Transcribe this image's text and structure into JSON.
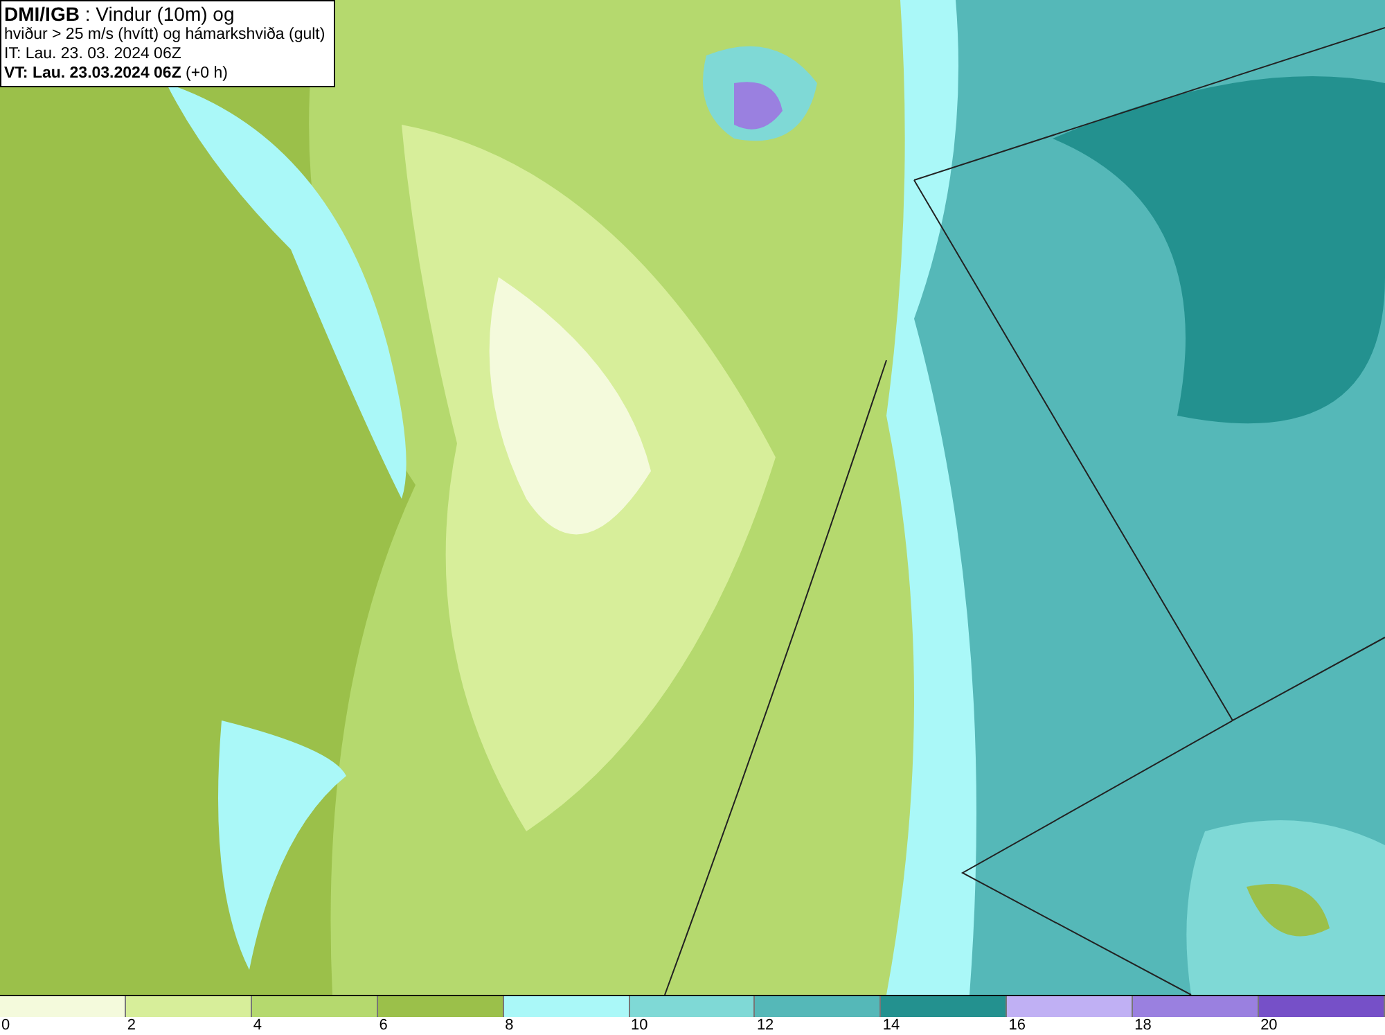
{
  "header": {
    "lines": [
      "**DMI/IGB** : Vindur (10m) og",
      "hviður > 25 m/s (hvítt) og hámarkshviða (gult)",
      "IT: Lau. 23. 03. 2024 06Z",
      "**VT: Lau. 23.03.2024 06Z** (+0 h)"
    ]
  },
  "legend": {
    "bins": [
      {
        "label": "0",
        "color": "#f4fadc"
      },
      {
        "label": "2",
        "color": "#d7ee9a"
      },
      {
        "label": "4",
        "color": "#b5d96e"
      },
      {
        "label": "6",
        "color": "#9bc04a"
      },
      {
        "label": "8",
        "color": "#aaf8f8"
      },
      {
        "label": "10",
        "color": "#7fd9d6"
      },
      {
        "label": "12",
        "color": "#55b8b8"
      },
      {
        "label": "14",
        "color": "#23918f"
      },
      {
        "label": "16",
        "color": "#c0b0f4"
      },
      {
        "label": "18",
        "color": "#9a80e0"
      },
      {
        "label": "20",
        "color": "#7650c8"
      }
    ]
  }
}
